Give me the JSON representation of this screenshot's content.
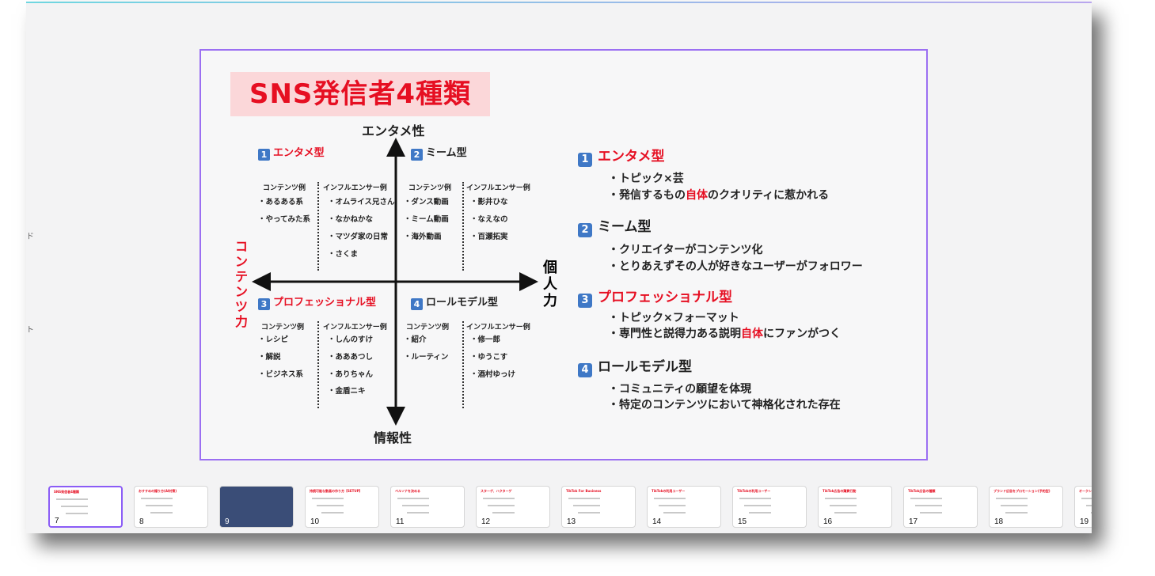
{
  "slide": {
    "title": "SNS発信者4種類",
    "axes": {
      "top": "エンタメ性",
      "bottom": "情報性",
      "left": "コンテンツ力",
      "right": "個人力"
    },
    "quadrants": [
      {
        "num": "1",
        "name": "エンタメ型",
        "name_color": "red",
        "content_header": "コンテンツ例",
        "content": [
          "・あるある系",
          "・やってみた系"
        ],
        "influencer_header": "インフルエンサー例",
        "influencers": [
          "・オムライス兄さん",
          "・なかねかな",
          "・マツダ家の日常",
          "・さくま"
        ]
      },
      {
        "num": "2",
        "name": "ミーム型",
        "name_color": "black",
        "content_header": "コンテンツ例",
        "content": [
          "・ダンス動画",
          "・ミーム動画",
          "・海外動画"
        ],
        "influencer_header": "インフルエンサー例",
        "influencers": [
          "・影井ひな",
          "・なえなの",
          "・百瀬拓実"
        ]
      },
      {
        "num": "3",
        "name": "プロフェッショナル型",
        "name_color": "red",
        "content_header": "コンテンツ例",
        "content": [
          "・レシピ",
          "・解説",
          "・ビジネス系"
        ],
        "influencer_header": "インフルエンサー例",
        "influencers": [
          "・しんのすけ",
          "・あああつし",
          "・ありちゃん",
          "・金盾ニキ"
        ]
      },
      {
        "num": "4",
        "name": "ロールモデル型",
        "name_color": "black",
        "content_header": "コンテンツ例",
        "content": [
          "・紹介",
          "・ルーティン"
        ],
        "influencer_header": "インフルエンサー例",
        "influencers": [
          "・修一郎",
          "・ゆうこす",
          "・酒村ゆっけ"
        ]
      }
    ],
    "right_panel": [
      {
        "num": "1",
        "name": "エンタメ型",
        "bullets": [
          [
            "・トピック×芸"
          ],
          [
            "・発信するもの",
            "自体",
            "のクオリティに惹かれる"
          ]
        ]
      },
      {
        "num": "2",
        "name": "ミーム型",
        "bullets": [
          [
            "・クリエイターがコンテンツ化"
          ],
          [
            "・とりあえずその人が好きなユーザーがフォロワー"
          ]
        ]
      },
      {
        "num": "3",
        "name": "プロフェッショナル型",
        "bullets": [
          [
            "・トピック×フォーマット"
          ],
          [
            "・専門性と説得力ある説明",
            "自体",
            "にファンがつく"
          ]
        ]
      },
      {
        "num": "4",
        "name": "ロールモデル型",
        "bullets": [
          [
            "・コミュニティの願望を体現"
          ],
          [
            "・特定のコンテンツにおいて神格化された存在"
          ]
        ]
      }
    ]
  },
  "edge_chars": [
    "ド",
    "ト"
  ],
  "filmstrip": [
    {
      "num": "7",
      "title": "SNS発信者4種類",
      "selected": true
    },
    {
      "num": "8",
      "title": "おすすめの撮り方(AI対策)"
    },
    {
      "num": "9",
      "title": "",
      "dark": true
    },
    {
      "num": "10",
      "title": "持続可能な動画の作り方【SETUP】"
    },
    {
      "num": "11",
      "title": "ペルソナを決める"
    },
    {
      "num": "12",
      "title": "スターゲ、ハクターゲ"
    },
    {
      "num": "13",
      "title": "TikTok For Business"
    },
    {
      "num": "14",
      "title": "TikTokの利用ユーザー"
    },
    {
      "num": "15",
      "title": "TikTokの利用ユーザー"
    },
    {
      "num": "16",
      "title": "TikTok広告の購買行動"
    },
    {
      "num": "17",
      "title": "TikTok広告の種類"
    },
    {
      "num": "18",
      "title": "ブランド広告をプロモーション(予約型)"
    },
    {
      "num": "19",
      "title": "オークション"
    }
  ],
  "colors": {
    "accent_red": "#e60f22",
    "badge_blue": "#3f78c6",
    "selection_purple": "#9b6ff2"
  }
}
